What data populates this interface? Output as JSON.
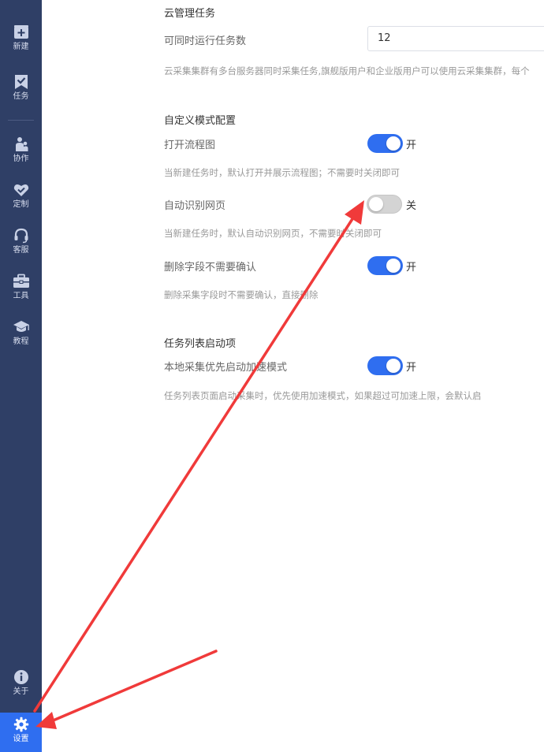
{
  "sidebar": {
    "items": [
      {
        "label": "新建",
        "icon": "plus-box-icon"
      },
      {
        "label": "任务",
        "icon": "task-check-icon"
      },
      {
        "label": "协作",
        "icon": "collaboration-people-icon"
      },
      {
        "label": "定制",
        "icon": "custom-heart-check-icon"
      },
      {
        "label": "客服",
        "icon": "headset-icon"
      },
      {
        "label": "工具",
        "icon": "toolbox-icon"
      },
      {
        "label": "教程",
        "icon": "graduation-cap-icon"
      },
      {
        "label": "关于",
        "icon": "info-icon"
      },
      {
        "label": "设置",
        "icon": "gear-icon",
        "active": true
      }
    ]
  },
  "sections": {
    "cloud": {
      "title": "云管理任务",
      "concurrent_label": "可同时运行任务数",
      "concurrent_value": "12",
      "desc": "云采集集群有多台服务器同时采集任务,旗舰版用户和企业版用户可以使用云采集集群，每个"
    },
    "custom": {
      "title": "自定义模式配置",
      "flowchart": {
        "label": "打开流程图",
        "state": "开",
        "on": true,
        "desc": "当新建任务时，默认打开并展示流程图；不需要时关闭即可"
      },
      "auto_detect": {
        "label": "自动识别网页",
        "state": "关",
        "on": false,
        "desc": "当新建任务时，默认自动识别网页，不需要时关闭即可"
      },
      "delete_field": {
        "label": "删除字段不需要确认",
        "state": "开",
        "on": true,
        "desc": "删除采集字段时不需要确认，直接删除"
      }
    },
    "tasklist": {
      "title": "任务列表启动项",
      "accelerate": {
        "label": "本地采集优先启动加速模式",
        "state": "开",
        "on": true,
        "desc": "任务列表页面启动采集时，优先使用加速模式，如果超过可加速上限，会默认启"
      }
    }
  },
  "colors": {
    "sidebar_bg": "#2f3f66",
    "accent": "#2f6ef0",
    "annotation_arrow": "#f03a3a"
  }
}
